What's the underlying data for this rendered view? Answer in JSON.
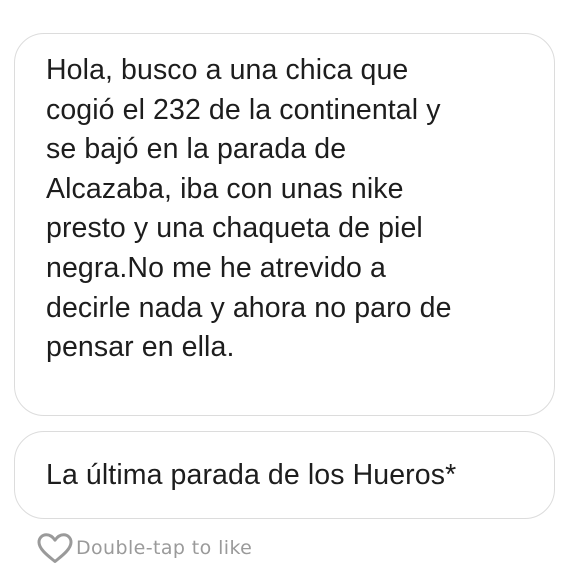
{
  "message": {
    "lines": [
      "Hola, busco a una chica que",
      "cogió el 232 de la continental y",
      "se bajó en la parada de",
      "Alcazaba, iba con unas nike",
      "presto y una chaqueta de piel",
      "negra.No me he atrevido a",
      "decirle nada y ahora no paro de",
      "pensar en ella."
    ]
  },
  "reply": {
    "text": "La última parada de los Hueros*"
  },
  "like": {
    "label": "Double-tap to like",
    "icon": "heart-outline-icon",
    "icon_color": "#9a9a9a"
  }
}
